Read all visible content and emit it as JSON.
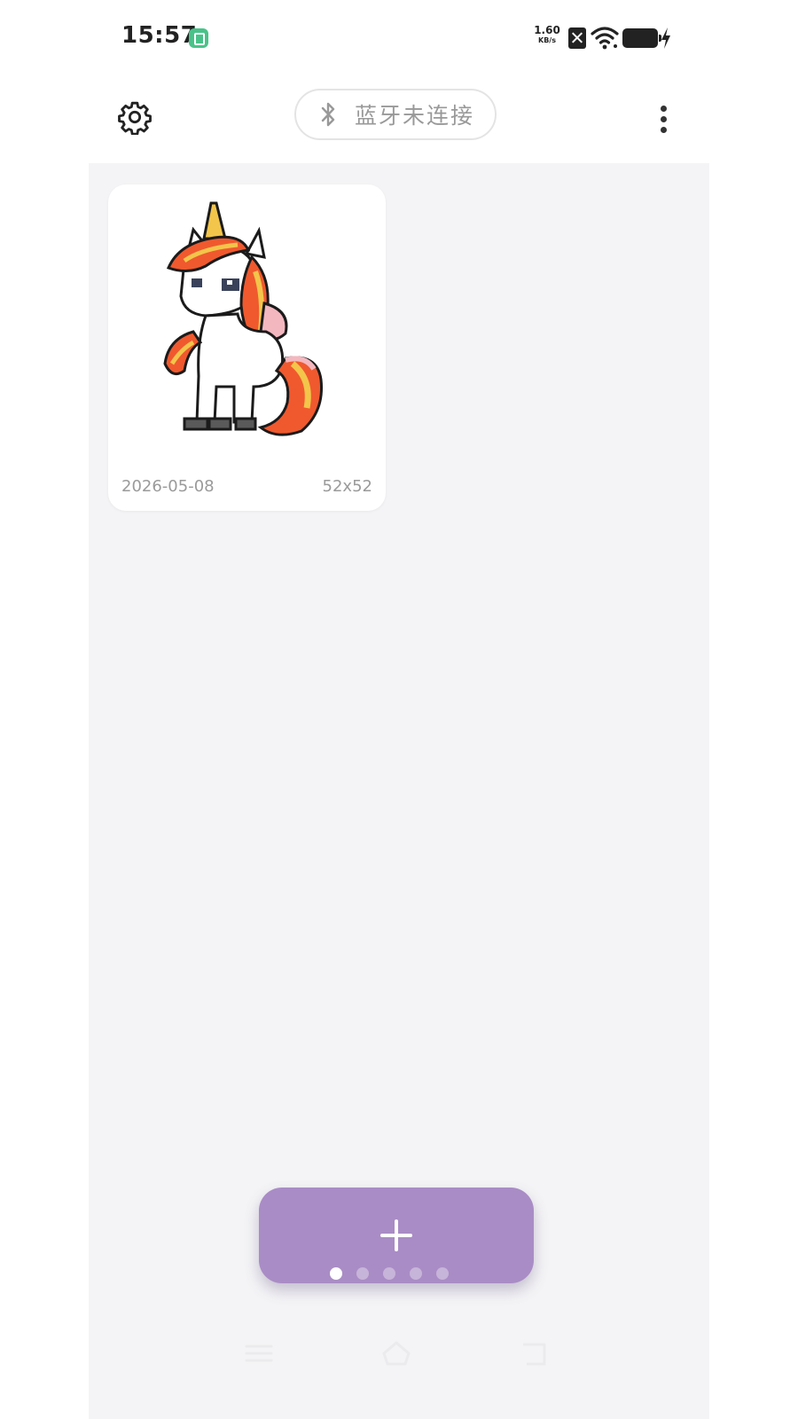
{
  "status_bar": {
    "time": "15:57",
    "net_speed_value": "1.60",
    "net_speed_unit": "KB/s",
    "icons": [
      "app-notification-icon",
      "sim-off-icon",
      "wifi-icon",
      "battery-icon",
      "charging-icon"
    ]
  },
  "topbar": {
    "settings_icon": "gear-icon",
    "bluetooth_status": "蓝牙未连接",
    "more_icon": "more-vertical-icon"
  },
  "items": [
    {
      "date": "2026-05-08",
      "size": "52x52",
      "thumbnail": "pixel-unicorn"
    }
  ],
  "fab": {
    "icon": "plus-icon",
    "pages": 5,
    "active_page": 1
  },
  "nav": {
    "icons": [
      "menu-icon",
      "home-icon",
      "back-icon"
    ]
  },
  "colors": {
    "accent": "#a98cc5",
    "background": "#f4f4f6",
    "card": "#ffffff",
    "muted_text": "#9a9a9a",
    "status_badge": "#49c289"
  }
}
